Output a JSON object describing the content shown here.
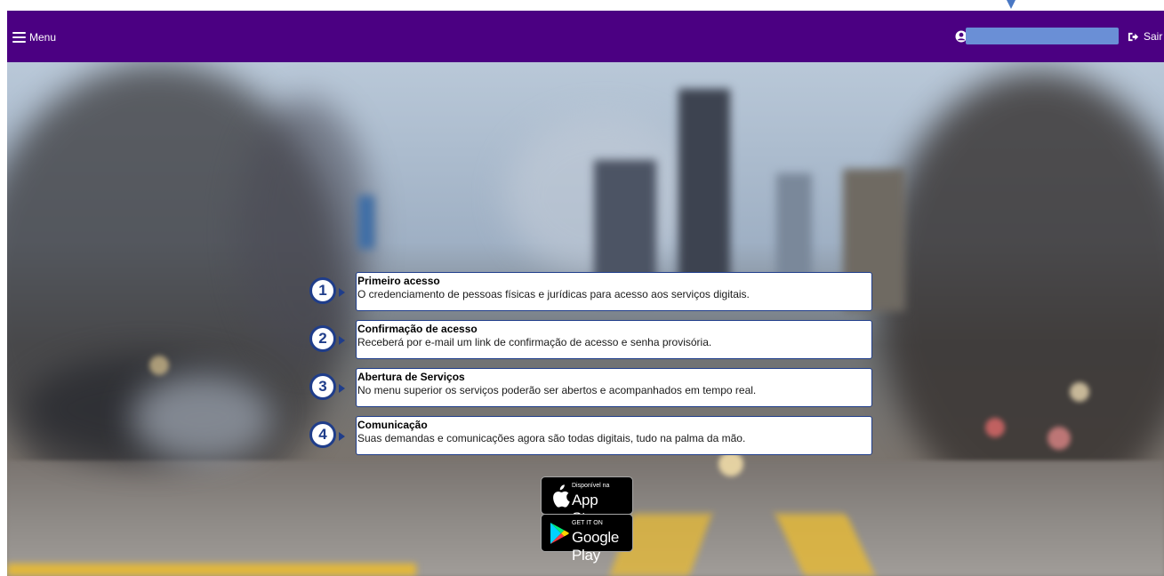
{
  "header": {
    "menu_label": "Menu",
    "logout_label": "Sair",
    "user_field_value": ""
  },
  "steps": [
    {
      "number": "1",
      "title": "Primeiro acesso",
      "description": "O credenciamento de pessoas físicas e jurídicas para acesso aos serviços digitais."
    },
    {
      "number": "2",
      "title": "Confirmação de acesso",
      "description": "Receberá por e-mail um link de confirmação de acesso e senha provisória."
    },
    {
      "number": "3",
      "title": "Abertura de Serviços",
      "description": "No menu superior os serviços poderão ser abertos e acompanhados em tempo real."
    },
    {
      "number": "4",
      "title": "Comunicação",
      "description": "Suas demandas e comunicações agora são todas digitais, tudo na palma da mão."
    }
  ],
  "stores": {
    "app_store": {
      "small": "Disponível na",
      "big": "App Store"
    },
    "google_play": {
      "small": "GET IT ON",
      "big": "Google Play"
    }
  },
  "colors": {
    "header_bg": "#4b0082",
    "accent": "#1f3d8a",
    "user_field": "#6a8fd6"
  },
  "icons": {
    "menu": "hamburger-icon",
    "user": "user-icon",
    "logout": "logout-icon",
    "apple": "apple-icon",
    "google_play": "google-play-icon"
  }
}
